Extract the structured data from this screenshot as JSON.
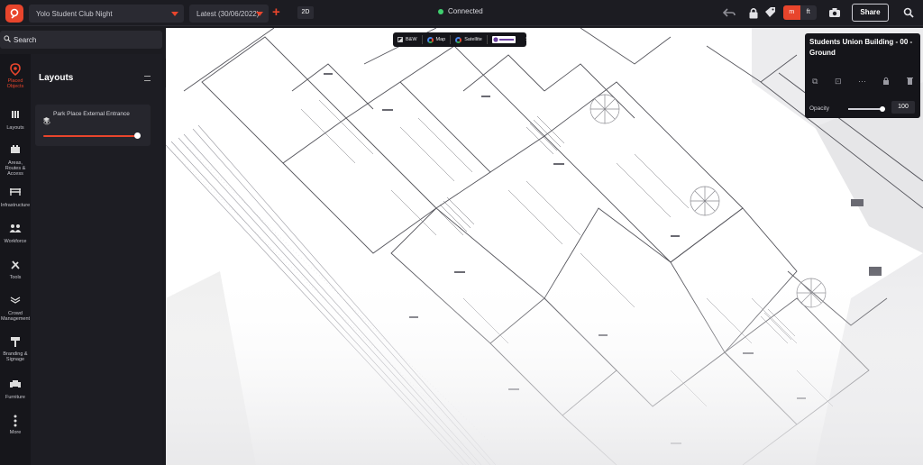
{
  "topbar": {
    "event_select": "Yolo Student Club Night",
    "version_select": "Latest (30/06/2022)",
    "view_mode": "2D",
    "status": "Connected",
    "seg_left": "m",
    "seg_right": "ft",
    "share": "Share",
    "accent_color": "#e8452c",
    "status_color": "#3fcf6f"
  },
  "sidebar": {
    "search_placeholder": "Search",
    "items": [
      {
        "label": "Placed Objects",
        "icon": "pin-icon"
      },
      {
        "label": "Layouts",
        "icon": "layers-icon"
      },
      {
        "label": "Areas, Routes & Access",
        "icon": "route-icon"
      },
      {
        "label": "Infrastructure",
        "icon": "barrier-icon"
      },
      {
        "label": "Workforce",
        "icon": "people-icon"
      },
      {
        "label": "Tools",
        "icon": "tools-icon"
      },
      {
        "label": "Crowd Management",
        "icon": "crowd-icon"
      },
      {
        "label": "Branding & Signage",
        "icon": "sign-icon"
      },
      {
        "label": "Furniture",
        "icon": "sofa-icon"
      },
      {
        "label": "More",
        "icon": "more-icon"
      }
    ]
  },
  "panel": {
    "title": "Layouts",
    "layout_item": "Park Place External Entrance",
    "layout_opacity": 1
  },
  "map_toolbar": {
    "bw": "B&W",
    "map": "Map",
    "satellite": "Satellite"
  },
  "properties": {
    "title": "Students Union Building - 00 - Ground",
    "opacity_label": "Opacity",
    "opacity_value": "100"
  }
}
